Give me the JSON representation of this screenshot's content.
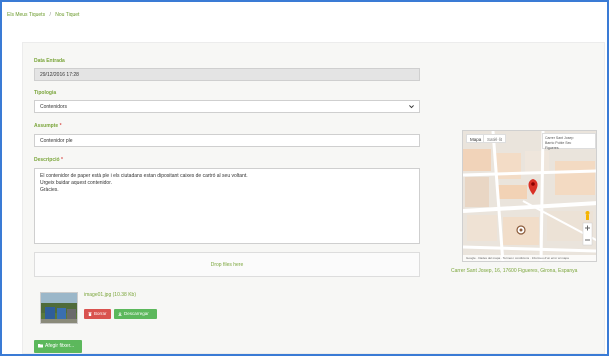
{
  "breadcrumb": {
    "item1": "Els Meus Tiquets",
    "separator": "/",
    "item2": "Nou Tiquet"
  },
  "form": {
    "date_label": "Data Entrada",
    "date_value": "29/12/2016 17:28",
    "type_label": "Tipologia",
    "type_value": "Contenidors",
    "subject_label": "Assumpte",
    "subject_value": "Contenidor ple",
    "description_label": "Descripció",
    "required_mark": "*",
    "description_lines": [
      "El contenidor de paper està ple i els ciutadans estan dipositant caixes de cartró al seu voltant.",
      "Urgeix buidar aquest contenidor.",
      "Gràcies."
    ],
    "dropzone_text": "Drop files here"
  },
  "attachment": {
    "file_name": "image01.jpg (10.38 Kb)",
    "delete_label": "Borrar",
    "download_label": "Descarregar"
  },
  "add_button_label": "Afegir fitxer...",
  "map": {
    "tab_map": "Mapa",
    "tab_satellite": "Satèl·lit",
    "info_line1": "Carrer Sant Josep",
    "info_line2": "Barrio Poble Sec",
    "info_line3": "Figueres",
    "footer": "Google · Dades del mapa · Termes i condicions · Informeu d'un error al mapa",
    "pin_color": "#d93025"
  },
  "address": "Carrer Sant Josep, 16, 17600 Figueres, Girona, Espanya",
  "colors": {
    "accent": "#7aa53a",
    "danger": "#d9534f",
    "success": "#5cb85c",
    "frame": "#3a7bd5"
  }
}
